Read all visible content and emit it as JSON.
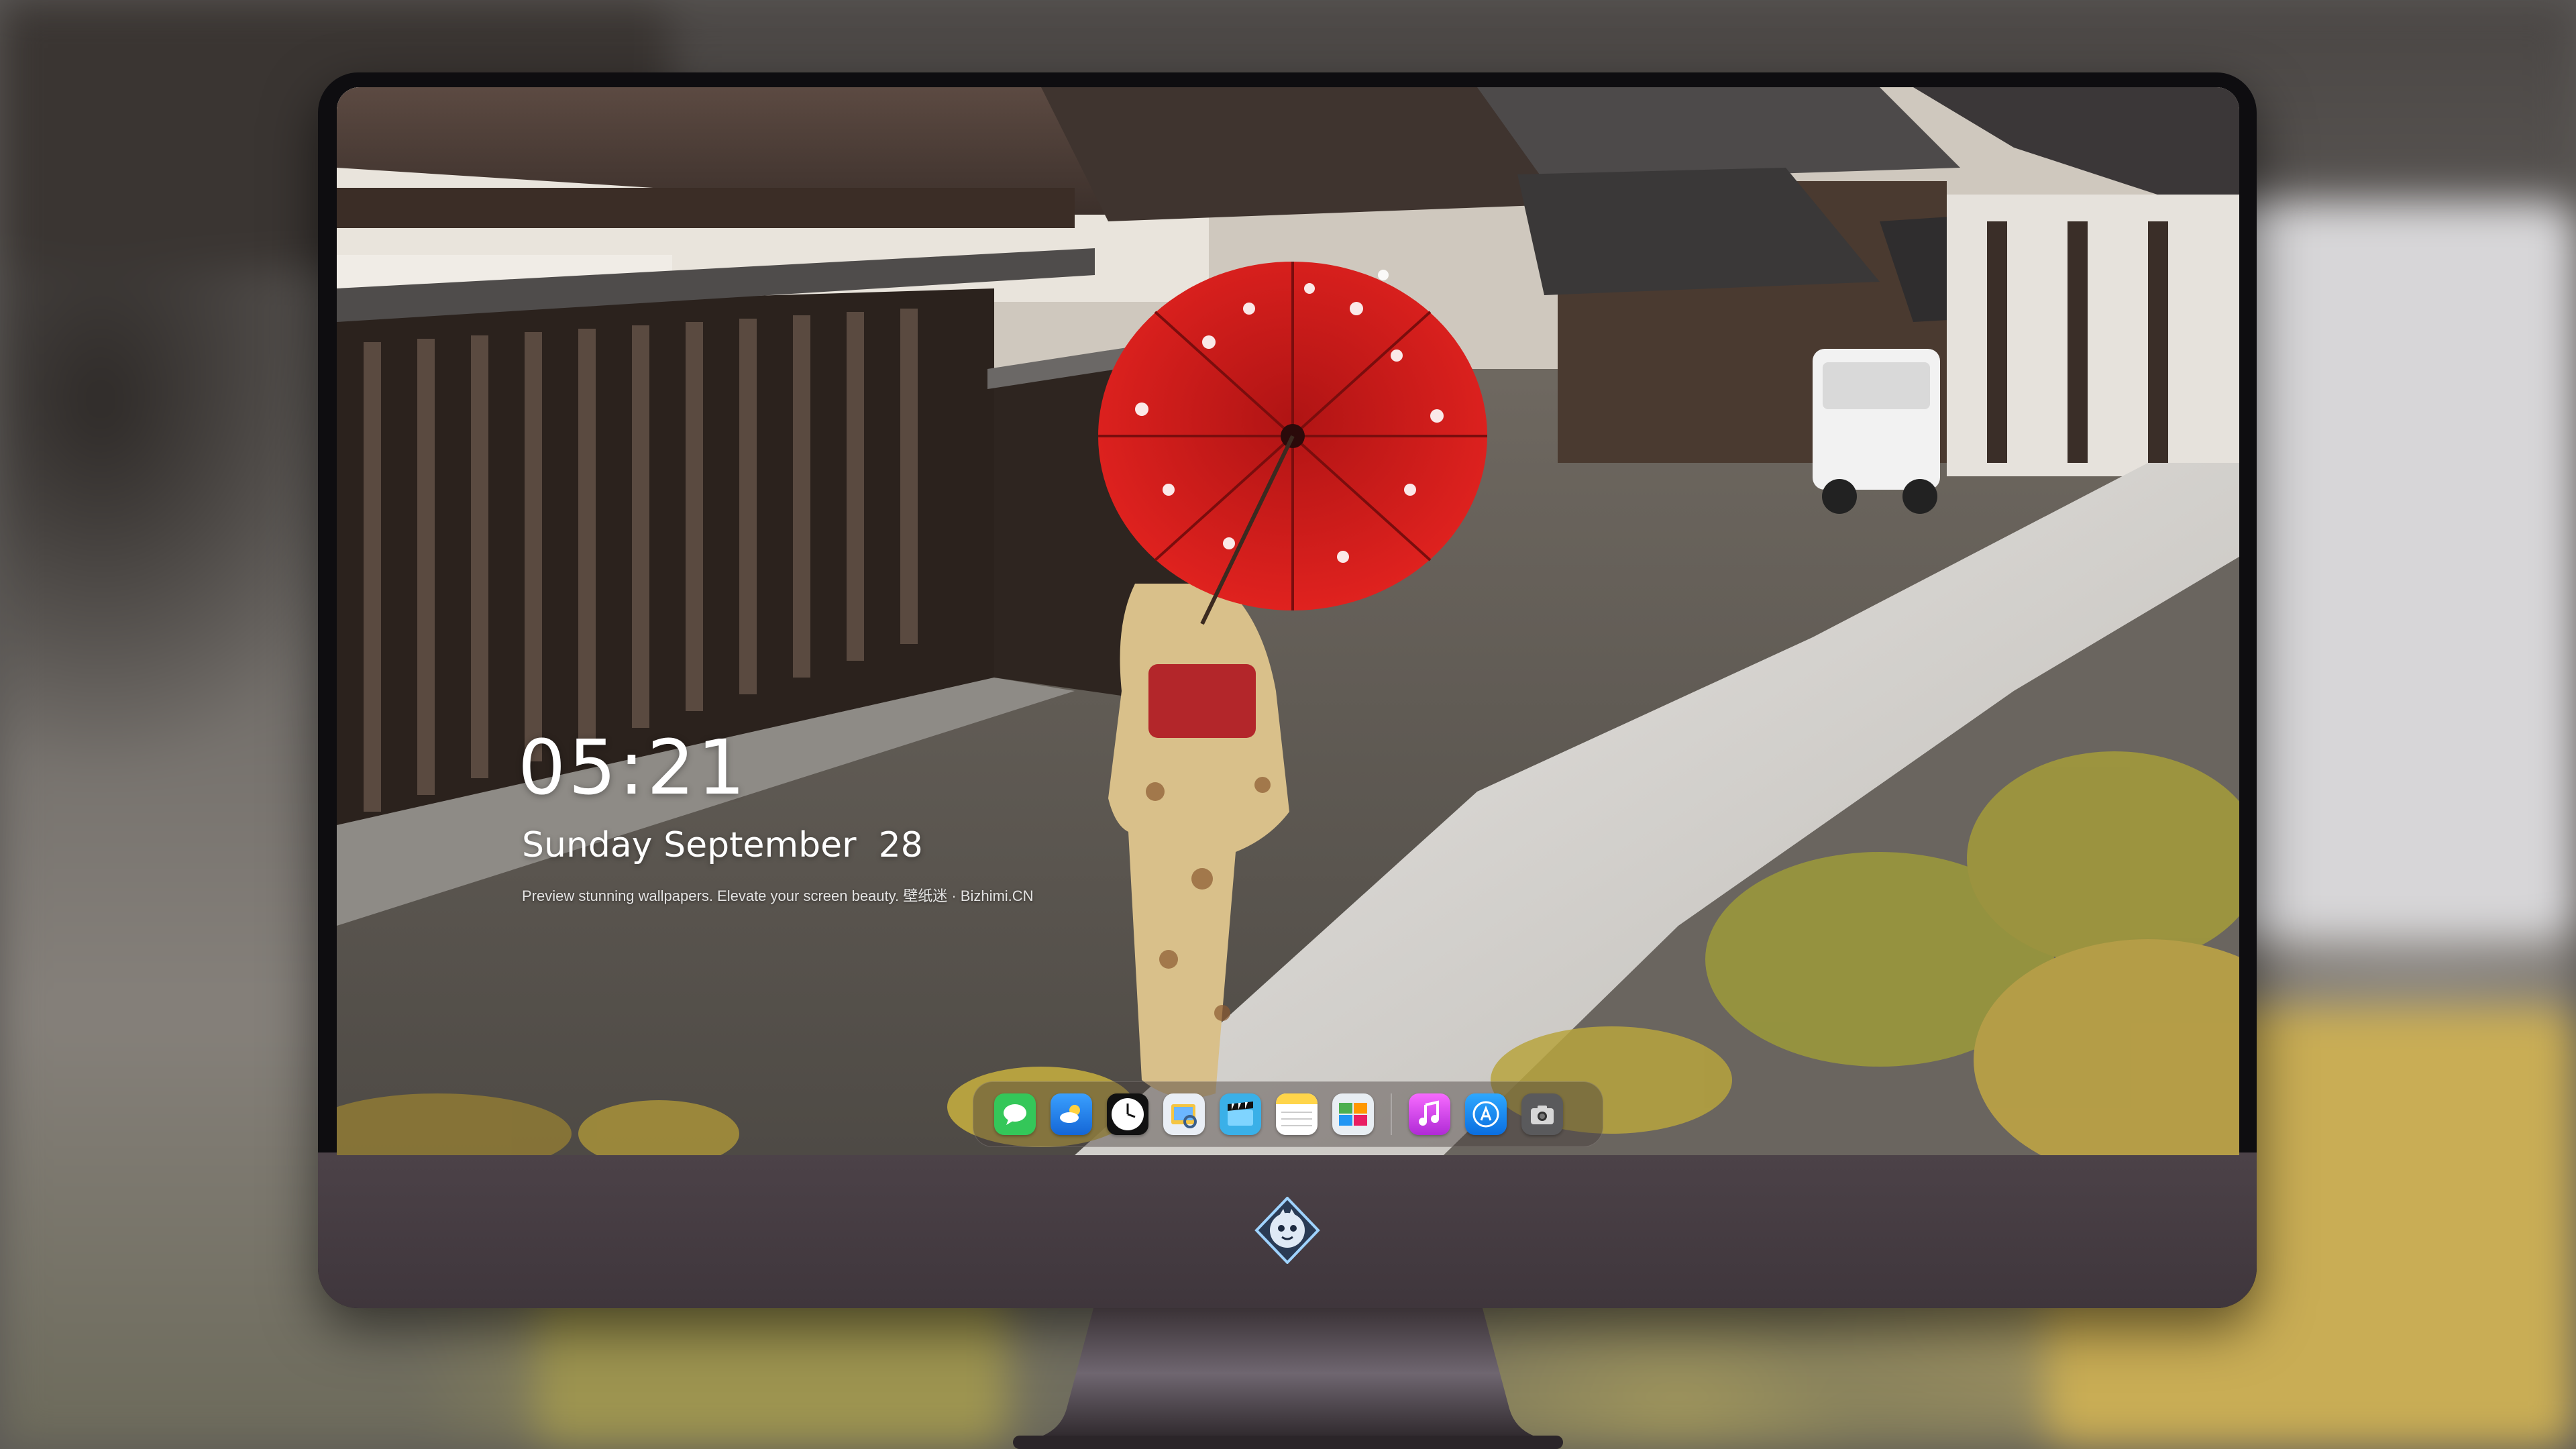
{
  "lock_screen": {
    "time": "05:21",
    "date": "Sunday September  28",
    "caption": "Preview stunning wallpapers. Elevate your screen beauty. 壁纸迷 · Bizhimi.CN"
  },
  "dock": {
    "apps": [
      {
        "name": "messages-icon",
        "color": "#34c759"
      },
      {
        "name": "weather-icon",
        "color": "#1e90ff"
      },
      {
        "name": "clock-icon",
        "color": "#ffffff"
      },
      {
        "name": "preview-icon",
        "color": "#f5c542"
      },
      {
        "name": "imovie-icon",
        "color": "#3ab0e8"
      },
      {
        "name": "notes-icon",
        "color": "#ffd54a"
      },
      {
        "name": "photo-browser-icon",
        "color": "#4caf50"
      },
      {
        "name": "music-icon",
        "color": "#e040fb"
      },
      {
        "name": "app-store-icon",
        "color": "#1a8cff"
      },
      {
        "name": "screenshot-icon",
        "color": "#555555"
      }
    ]
  },
  "chin": {
    "logo": "mascot-logo-icon"
  },
  "colors": {
    "umbrella": "#d81e1e",
    "kimono": "#d9c08a",
    "obi": "#b3262a",
    "monitor_chin": "#463c42"
  }
}
